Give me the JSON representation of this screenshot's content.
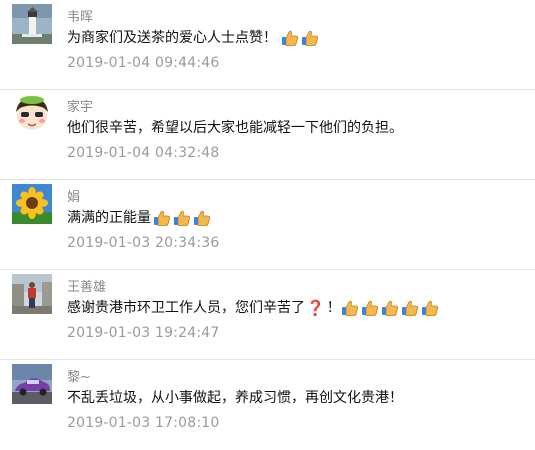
{
  "comments": [
    {
      "username": "韦晖",
      "text": "为商家们及送茶的爱心人士点赞！",
      "emoji_count": 2,
      "time": "2019-01-04 09:44:46",
      "avatar": "lighthouse-avatar"
    },
    {
      "username": "家宇",
      "text": "他们很辛苦，希望以后大家也能减轻一下他们的负担。",
      "emoji_count": 0,
      "time": "2019-01-04 04:32:48",
      "avatar": "cartoon-girl-avatar"
    },
    {
      "username": "娟",
      "text": "满满的正能量",
      "emoji_count": 3,
      "time": "2019-01-03 20:34:36",
      "avatar": "sunflower-avatar"
    },
    {
      "username": "王善雄",
      "text": "感谢贵港市环卫工作人员，您们辛苦了",
      "question_mark": "❓",
      "after_text": "！",
      "emoji_count": 5,
      "time": "2019-01-03 19:24:47",
      "avatar": "person-standing-avatar"
    },
    {
      "username": "黎~",
      "text": "不乱丢垃圾，从小事做起，养成习惯，再创文化贵港！",
      "emoji_count": 0,
      "time": "2019-01-03 17:08:10",
      "avatar": "purple-car-avatar"
    }
  ],
  "icons": {
    "emoji": "thumbs-up-icon",
    "question_mark_color": "#d0161d"
  },
  "colors": {
    "username": "#888888",
    "text": "#111111",
    "time": "#9a9a9a",
    "divider": "#e5e5e5"
  }
}
